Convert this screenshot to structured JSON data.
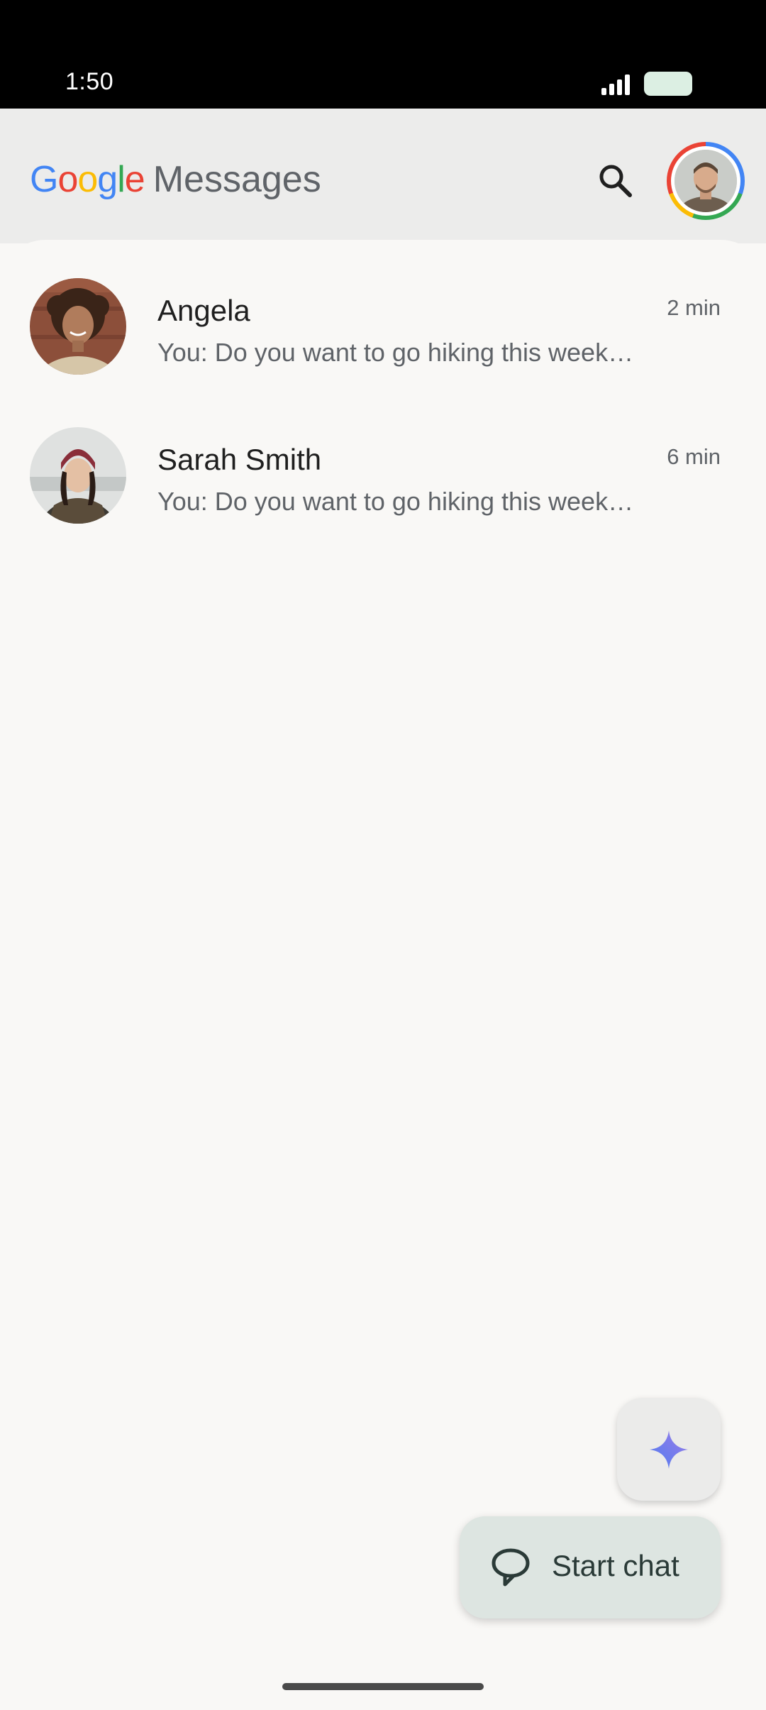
{
  "status_bar": {
    "time": "1:50",
    "icons": [
      "signal-icon",
      "battery-icon"
    ]
  },
  "header": {
    "logo_letters": [
      {
        "char": "G",
        "color": "#4285f4"
      },
      {
        "char": "o",
        "color": "#ea4335"
      },
      {
        "char": "o",
        "color": "#fbbc05"
      },
      {
        "char": "g",
        "color": "#4285f4"
      },
      {
        "char": "l",
        "color": "#34a853"
      },
      {
        "char": "e",
        "color": "#ea4335"
      }
    ],
    "app_name": "Messages",
    "search_icon": "search-icon",
    "profile_icon": "profile-avatar"
  },
  "conversations": [
    {
      "name": "Angela",
      "snippet": "You: Do you want to go hiking this week…",
      "time": "2 min"
    },
    {
      "name": "Sarah Smith",
      "snippet": "You: Do you want to go hiking this week…",
      "time": "6 min"
    }
  ],
  "fabs": {
    "gemini_icon": "sparkle-icon",
    "start_chat_label": "Start chat",
    "start_chat_icon": "chat-bubble-icon"
  },
  "colors": {
    "background": "#f9f8f6",
    "header_background": "#ececeb",
    "start_chat_fab": "#dde5e1",
    "gemini_fab": "#ebebea"
  }
}
